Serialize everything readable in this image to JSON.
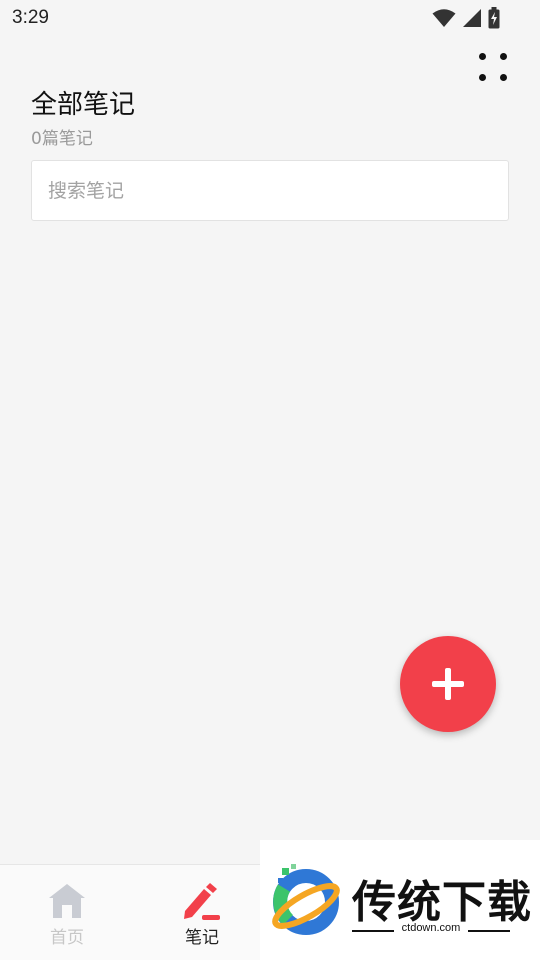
{
  "status_bar": {
    "time": "3:29",
    "icons": [
      "wifi-icon",
      "cell-signal-icon",
      "battery-charging-icon"
    ]
  },
  "header": {
    "more_icon": "grid-dots-icon",
    "title": "全部笔记",
    "count": "0篇笔记"
  },
  "search": {
    "placeholder": "搜索笔记",
    "value": ""
  },
  "fab": {
    "icon": "plus-icon",
    "color": "#f2404a"
  },
  "bottom_nav": {
    "items": [
      {
        "label": "首页",
        "icon": "home-icon",
        "active": false,
        "color": "#c7c7c7"
      },
      {
        "label": "笔记",
        "icon": "pencil-icon",
        "active": true,
        "color": "#f2404a"
      }
    ]
  },
  "watermark": {
    "brand": "传统下载",
    "domain": "ctdown.com"
  },
  "colors": {
    "accent": "#f2404a",
    "background": "#f5f5f5",
    "muted_text": "#9a9a9a"
  }
}
